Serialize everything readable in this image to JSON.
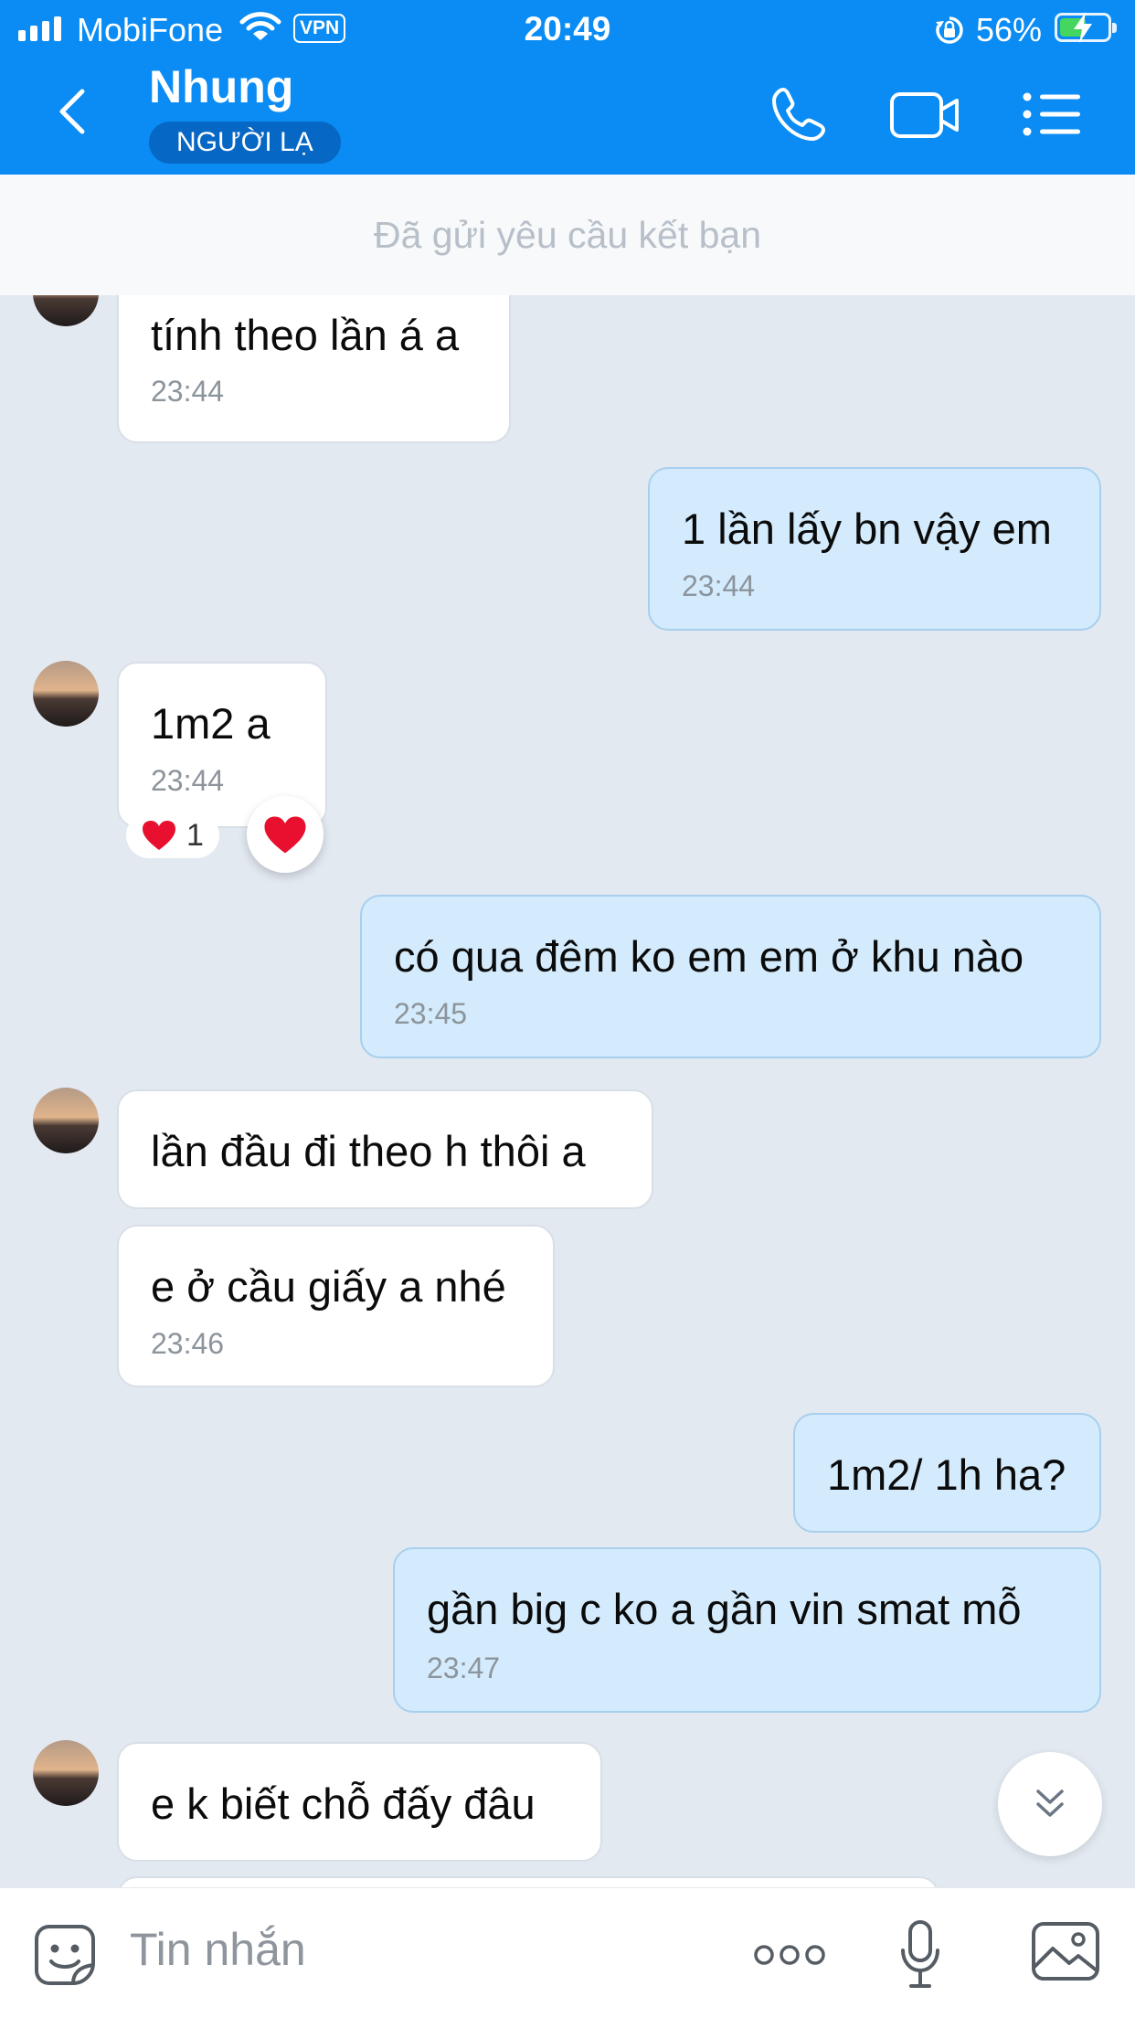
{
  "status_bar": {
    "carrier": "MobiFone",
    "vpn": "VPN",
    "time": "20:49",
    "battery_percent": "56%",
    "battery_level": 0.56,
    "battery_color": "#44d65f"
  },
  "header": {
    "contact_name": "Nhung",
    "tag": "NGƯỜI LẠ",
    "background": "#0a8cf4",
    "icons": [
      "back-chevron-icon",
      "phone-icon",
      "video-call-icon",
      "menu-icon"
    ]
  },
  "friend_request_notice": "Đã gửi yêu cầu kết bạn",
  "messages": [
    {
      "direction": "incoming",
      "text": "tính theo lần á a",
      "time": "23:44"
    },
    {
      "direction": "outgoing",
      "text": "1 lần lấy bn vậy em",
      "time": "23:44"
    },
    {
      "direction": "incoming",
      "text": "1m2 a",
      "time": "23:44",
      "reaction": {
        "icon": "heart-icon",
        "count": "1"
      }
    },
    {
      "direction": "outgoing",
      "text": "có qua đêm ko em em ở khu nào",
      "time": "23:45"
    },
    {
      "direction": "incoming",
      "text": "lần đầu đi theo h thôi a"
    },
    {
      "direction": "incoming",
      "text": "e ở cầu giấy a nhé",
      "time": "23:46"
    },
    {
      "direction": "outgoing",
      "text": "1m2/ 1h ha?"
    },
    {
      "direction": "outgoing",
      "text": "gần big c ko a gần vin smat mỗ",
      "time": "23:47"
    },
    {
      "direction": "incoming",
      "text": "e k biết chỗ đấy đâu"
    }
  ],
  "input_bar": {
    "placeholder": "Tin nhắn",
    "icons": [
      "sticker-icon",
      "more-icon",
      "microphone-icon",
      "image-icon"
    ]
  }
}
